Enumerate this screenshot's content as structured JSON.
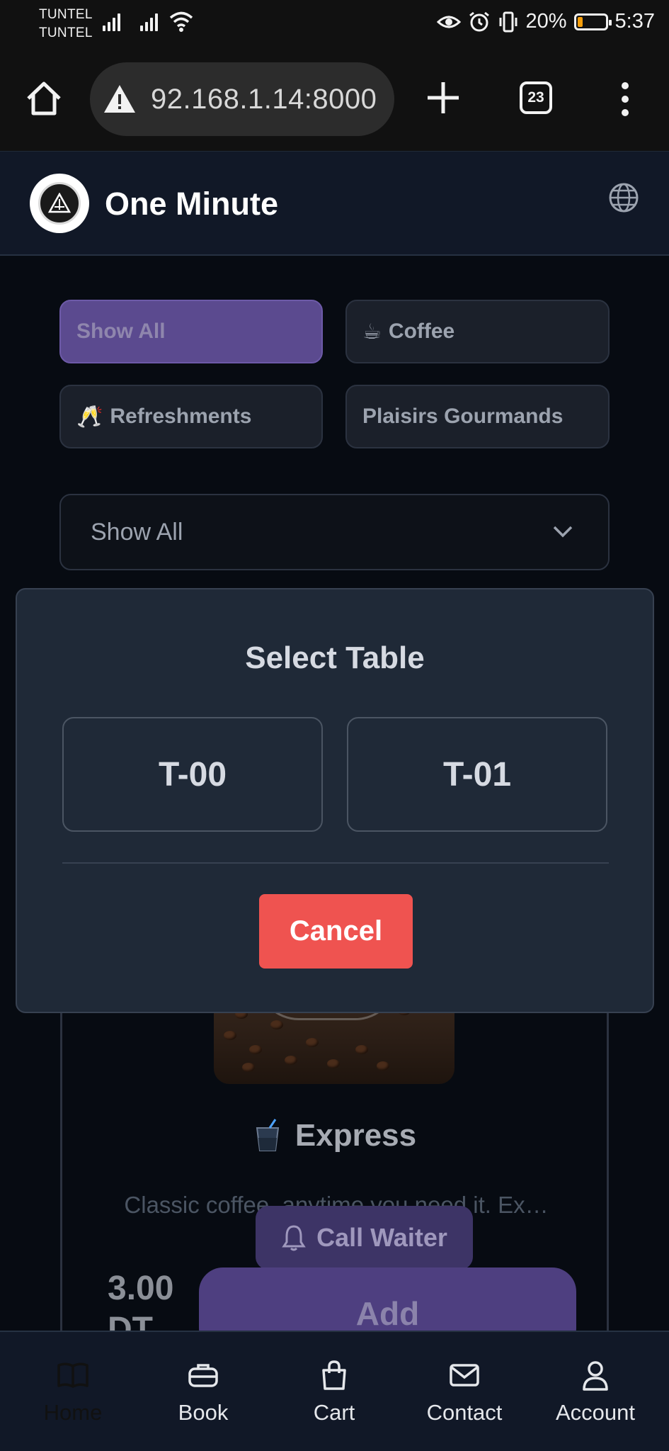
{
  "status_bar": {
    "carrier_1": "TUNTEL",
    "carrier_2": "TUNTEL",
    "battery": "20%",
    "battery_level": 0.2,
    "time": "5:37"
  },
  "browser": {
    "url": "92.168.1.14:8000",
    "tab_count": "23"
  },
  "header": {
    "brand": "One Minute"
  },
  "filters": [
    {
      "label": "Show All",
      "icon": "",
      "active": true
    },
    {
      "label": "Coffee",
      "icon": "☕",
      "active": false
    },
    {
      "label": "Refreshments",
      "icon": "🥂",
      "active": false
    },
    {
      "label": "Plaisirs Gourmands",
      "icon": "",
      "active": false
    }
  ],
  "select": {
    "value": "Show All"
  },
  "modal": {
    "title": "Select Table",
    "tables": [
      "T-00",
      "T-01"
    ],
    "cancel_label": "Cancel"
  },
  "product": {
    "name": "Express",
    "description": "Classic coffee, anytime you need it. Ex…",
    "price": "3.00 DT",
    "add_label": "Add"
  },
  "call_waiter_label": "Call Waiter",
  "nav": [
    {
      "label": "Home",
      "icon": "book-icon",
      "active": true
    },
    {
      "label": "Book",
      "icon": "briefcase-icon",
      "active": false
    },
    {
      "label": "Cart",
      "icon": "shopping-bag-icon",
      "active": false
    },
    {
      "label": "Contact",
      "icon": "mail-icon",
      "active": false
    },
    {
      "label": "Account",
      "icon": "user-icon",
      "active": false
    }
  ]
}
